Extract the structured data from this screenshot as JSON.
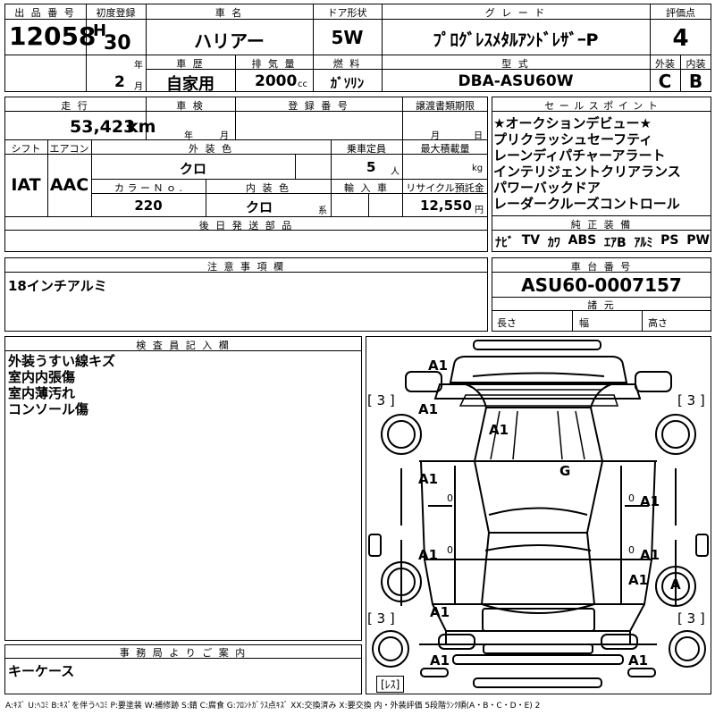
{
  "header": {
    "lot_no_label": "出 品 番 号",
    "lot_no": "12058",
    "first_reg_label": "初度登録",
    "era": "H",
    "year": "30",
    "year_unit": "年",
    "month": "2",
    "month_unit": "月",
    "car_name_label": "車 名",
    "car_name": "ハリアー",
    "door_label": "ドア形状",
    "door": "5W",
    "grade_label": "グ レ ー ド",
    "grade": "ﾌﾟﾛｸﾞﾚｽﾒﾀﾙｱﾝﾄﾞﾚｻﾞｰP",
    "score_label": "評価点",
    "score": "4",
    "history_label": "車 歴",
    "history": "自家用",
    "displacement_label": "排 気 量",
    "displacement": "2000",
    "displacement_unit": "cc",
    "fuel_label": "燃 料",
    "fuel": "ｶﾞｿﾘﾝ",
    "model_label": "型 式",
    "model": "DBA-ASU60W",
    "exterior_label": "外装",
    "exterior": "C",
    "interior_label": "内装",
    "interior": "B"
  },
  "row2": {
    "mileage_label": "走 行",
    "mileage": "53,423",
    "mileage_unit": "km",
    "inspection_label": "車 検",
    "year_unit": "年",
    "month_unit": "月",
    "reg_no_label": "登 録 番 号",
    "transfer_label": "譲渡書類期限",
    "transfer_month": "月",
    "transfer_day": "日",
    "shift_label": "シフト",
    "shift": "IAT",
    "ac_label": "エアコン",
    "ac": "AAC",
    "ext_color_label": "外 装 色",
    "ext_color": "クロ",
    "capacity_label": "乗車定員",
    "capacity": "5",
    "capacity_unit": "人",
    "max_load_label": "最大積載量",
    "max_load_unit": "kg",
    "color_no_label": "カ ラ ー Ｎ ｏ .",
    "color_no": "220",
    "int_color_label": "内 装 色",
    "int_color": "クロ",
    "int_color_unit": "系",
    "import_label": "輸 入 車",
    "recycle_label": "リサイクル預託金",
    "recycle": "12,550",
    "recycle_unit": "円",
    "later_parts_label": "後 日 発 送 部 品"
  },
  "sales_points": {
    "label": "セ ー ル ス ポ イ ン ト",
    "items": [
      "★オークションデビュー★",
      "プリクラッシュセーフティ",
      "レーンディパチャーアラート",
      "インテリジェントクリアランス",
      "パワーバックドア",
      "レーダークルーズコントロール"
    ]
  },
  "equipment": {
    "label": "純 正 装 備",
    "items": [
      "ﾅﾋﾞ",
      "TV",
      "ｶﾜ",
      "ABS",
      "ｴｱB",
      "ｱﾙﾐ",
      "PS",
      "PW"
    ]
  },
  "notes": {
    "label": "注 意 事 項 欄",
    "text": "18インチアルミ"
  },
  "chassis": {
    "label": "車 台 番 号",
    "number": "ASU60-0007157",
    "spec_label": "諸 元",
    "length_label": "長さ",
    "width_label": "幅",
    "height_label": "高さ"
  },
  "inspector": {
    "label": "検 査 員 記 入 欄",
    "items": [
      "外装うすい線キズ",
      "室内内張傷",
      "室内薄汚れ",
      "コンソール傷"
    ]
  },
  "office": {
    "label": "事 務 局 よ り ご 案 内",
    "text": "キーケース"
  },
  "diagram": {
    "marks": [
      "A1",
      "A1",
      "A1",
      "G",
      "A1",
      "A1",
      "A1",
      "A1",
      "A1",
      "A1",
      "A1",
      "A1",
      "A"
    ],
    "tire_label": "[ 3 ]",
    "zero": "0",
    "rest_label": "[ﾚｽ]"
  },
  "legend": "A:ｷｽﾞ U:ﾍｺﾐ B:ｷｽﾞを伴うﾍｺﾐ P:要塗装 W:補修跡 S:錆 C:腐食 G:ﾌﾛﾝﾄｶﾞﾗｽ点ｷｽﾞ XX:交換済み X:要交換 内・外装評価 5段階ﾗﾝｸ順(A・B・C・D・E) 2"
}
